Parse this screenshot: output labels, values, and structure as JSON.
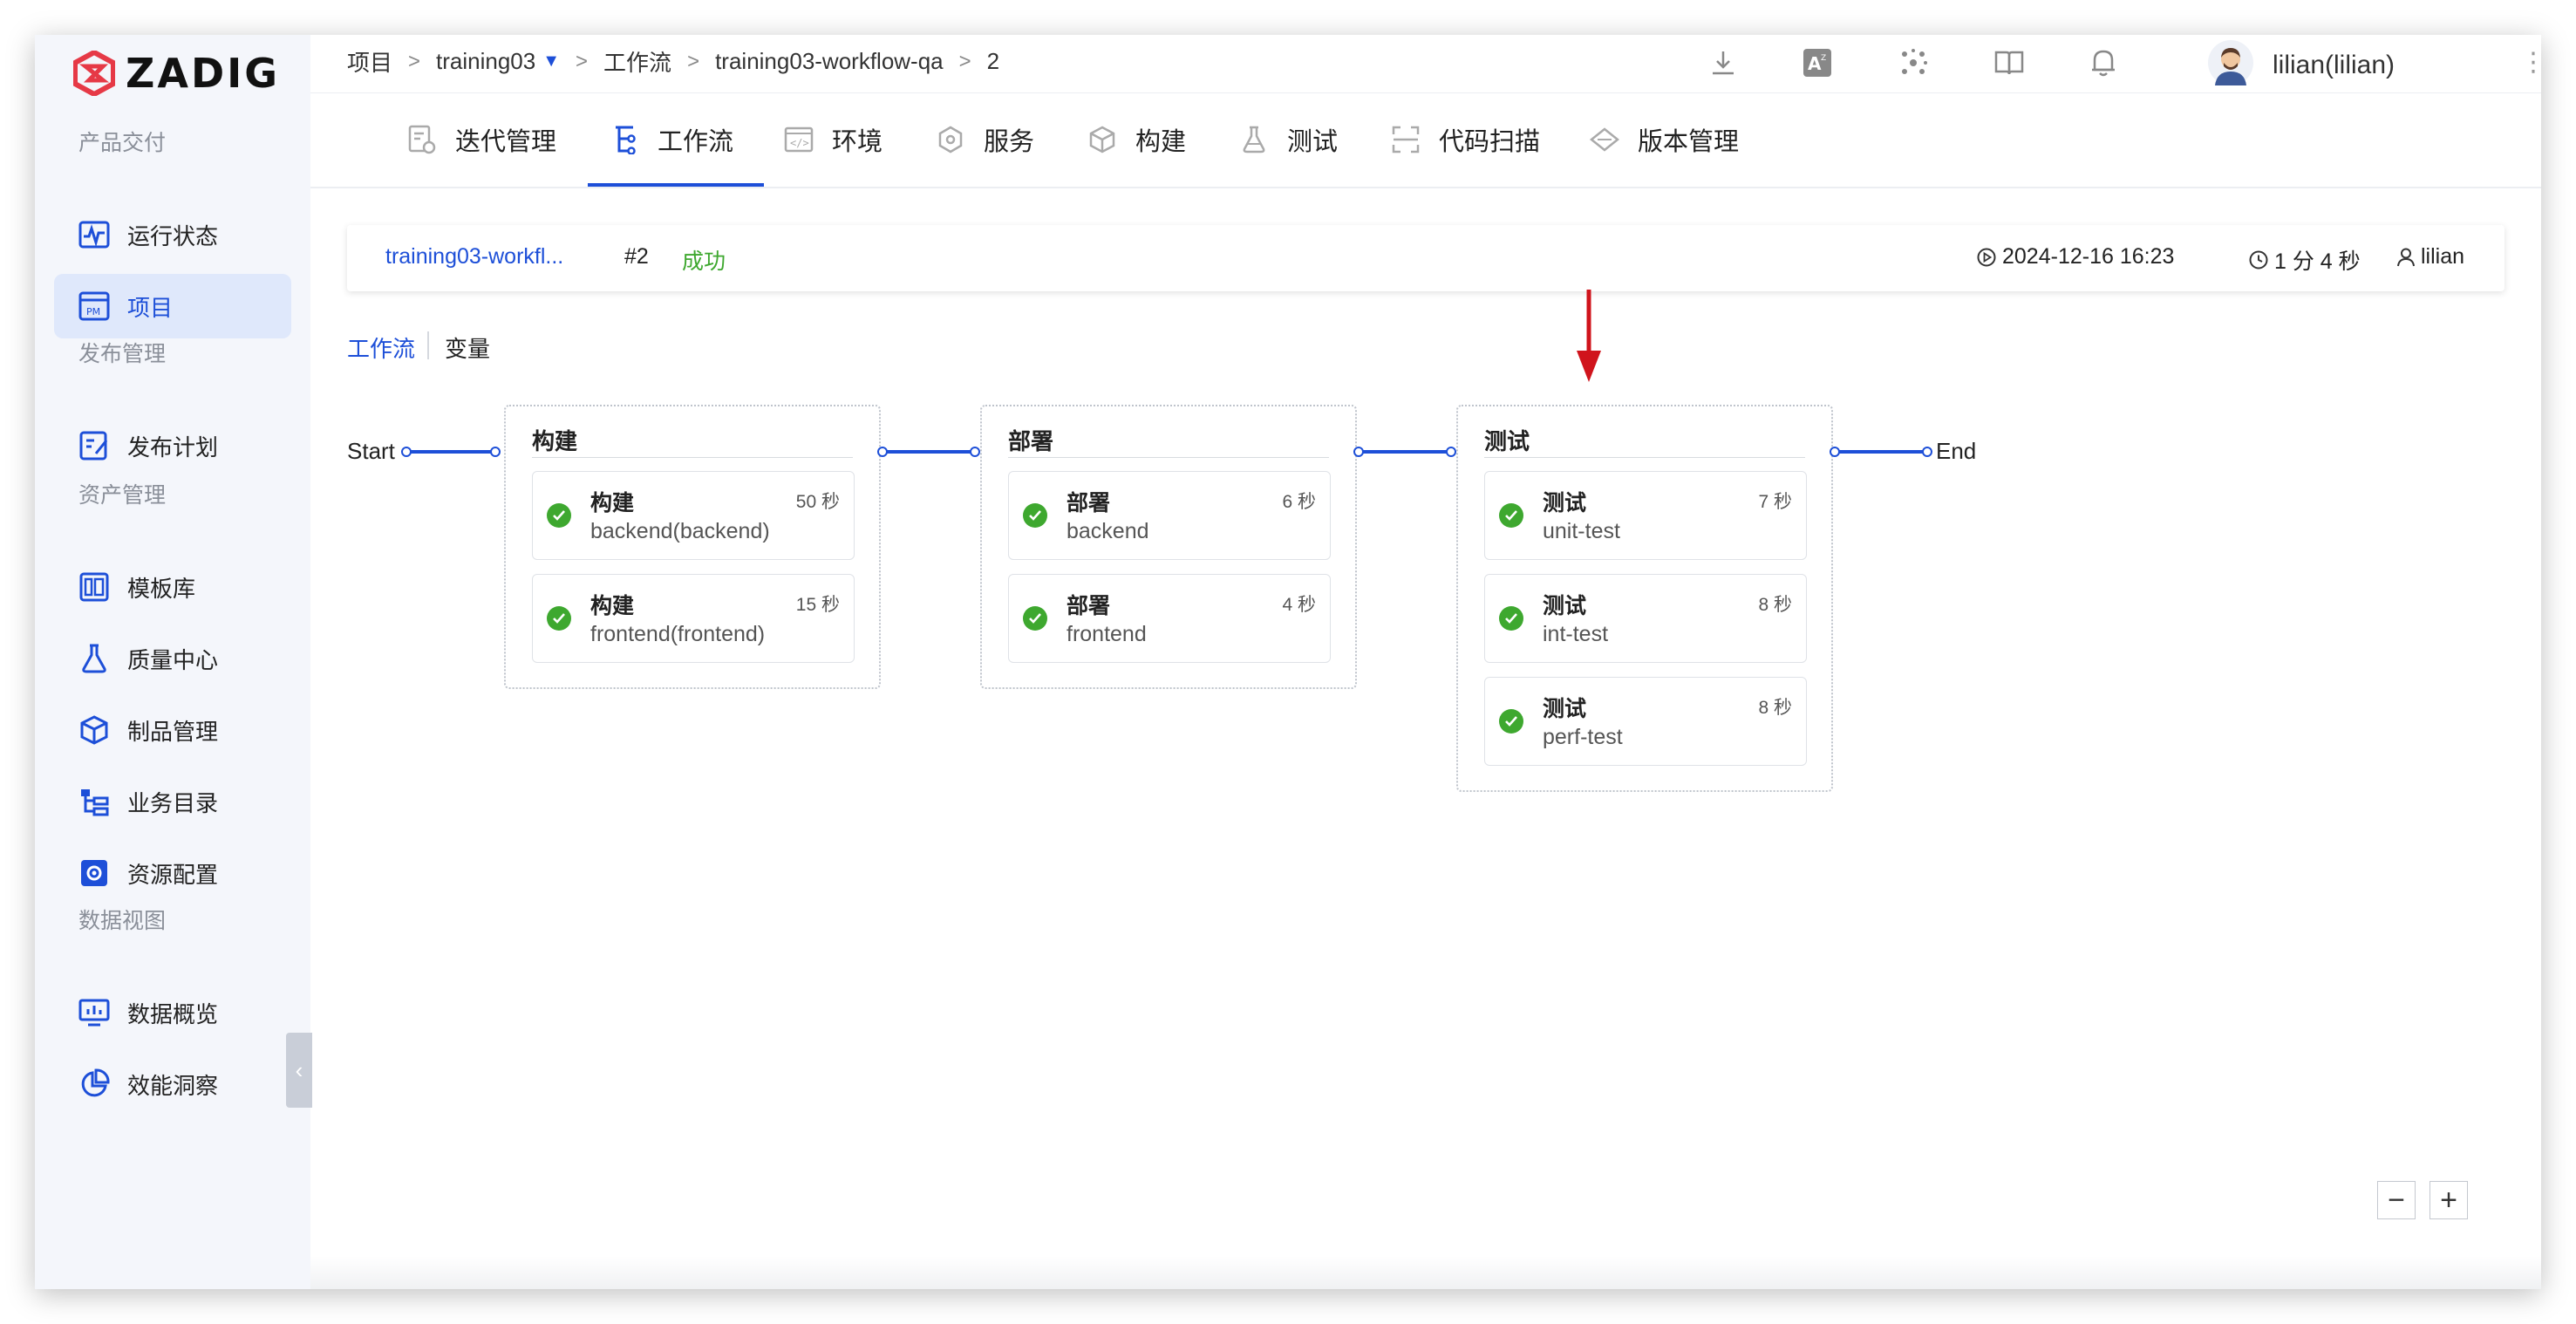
{
  "app": {
    "logo_text": "ZADIG",
    "brand_color": "#e63946",
    "accent_color": "#1d4fd8",
    "success_color": "#3ea82f"
  },
  "sidebar": {
    "sections": [
      {
        "title": "产品交付",
        "items": [
          {
            "label": "运行状态",
            "icon": "pulse-icon"
          },
          {
            "label": "项目",
            "icon": "project-pm-icon",
            "active": true
          }
        ]
      },
      {
        "title": "发布管理",
        "items": [
          {
            "label": "发布计划",
            "icon": "release-plan-icon"
          }
        ]
      },
      {
        "title": "资产管理",
        "items": [
          {
            "label": "模板库",
            "icon": "template-icon"
          },
          {
            "label": "质量中心",
            "icon": "flask-icon"
          },
          {
            "label": "制品管理",
            "icon": "package-icon"
          },
          {
            "label": "业务目录",
            "icon": "catalog-icon"
          },
          {
            "label": "资源配置",
            "icon": "resource-gear-icon"
          }
        ]
      },
      {
        "title": "数据视图",
        "items": [
          {
            "label": "数据概览",
            "icon": "monitor-chart-icon"
          },
          {
            "label": "效能洞察",
            "icon": "pie-chart-icon"
          }
        ]
      }
    ]
  },
  "breadcrumb": [
    "项目",
    "training03",
    "工作流",
    "training03-workflow-qa",
    "2"
  ],
  "header": {
    "user_name": "lilian(lilian)"
  },
  "tabs": [
    {
      "label": "迭代管理",
      "icon": "iteration-icon"
    },
    {
      "label": "工作流",
      "icon": "workflow-icon",
      "active": true
    },
    {
      "label": "环境",
      "icon": "environment-icon"
    },
    {
      "label": "服务",
      "icon": "service-icon"
    },
    {
      "label": "构建",
      "icon": "build-cube-icon"
    },
    {
      "label": "测试",
      "icon": "test-flask-icon"
    },
    {
      "label": "代码扫描",
      "icon": "scan-icon"
    },
    {
      "label": "版本管理",
      "icon": "version-icon"
    }
  ],
  "run": {
    "workflow_name": "training03-workfl...",
    "run_id": "#2",
    "status": "成功",
    "start_time": "2024-12-16 16:23",
    "duration": "1 分 4 秒",
    "creator": "lilian"
  },
  "view_tabs": {
    "workflow": "工作流",
    "variables": "变量"
  },
  "pipeline": {
    "start_label": "Start",
    "end_label": "End",
    "stages": [
      {
        "title": "构建",
        "jobs": [
          {
            "type": "构建",
            "name": "backend(backend)",
            "duration": "50 秒"
          },
          {
            "type": "构建",
            "name": "frontend(frontend)",
            "duration": "15 秒"
          }
        ]
      },
      {
        "title": "部署",
        "jobs": [
          {
            "type": "部署",
            "name": "backend",
            "duration": "6 秒"
          },
          {
            "type": "部署",
            "name": "frontend",
            "duration": "4 秒"
          }
        ]
      },
      {
        "title": "测试",
        "jobs": [
          {
            "type": "测试",
            "name": "unit-test",
            "duration": "7 秒"
          },
          {
            "type": "测试",
            "name": "int-test",
            "duration": "8 秒"
          },
          {
            "type": "测试",
            "name": "perf-test",
            "duration": "8 秒"
          }
        ]
      }
    ]
  },
  "zoom": {
    "out_label": "−",
    "in_label": "+"
  }
}
